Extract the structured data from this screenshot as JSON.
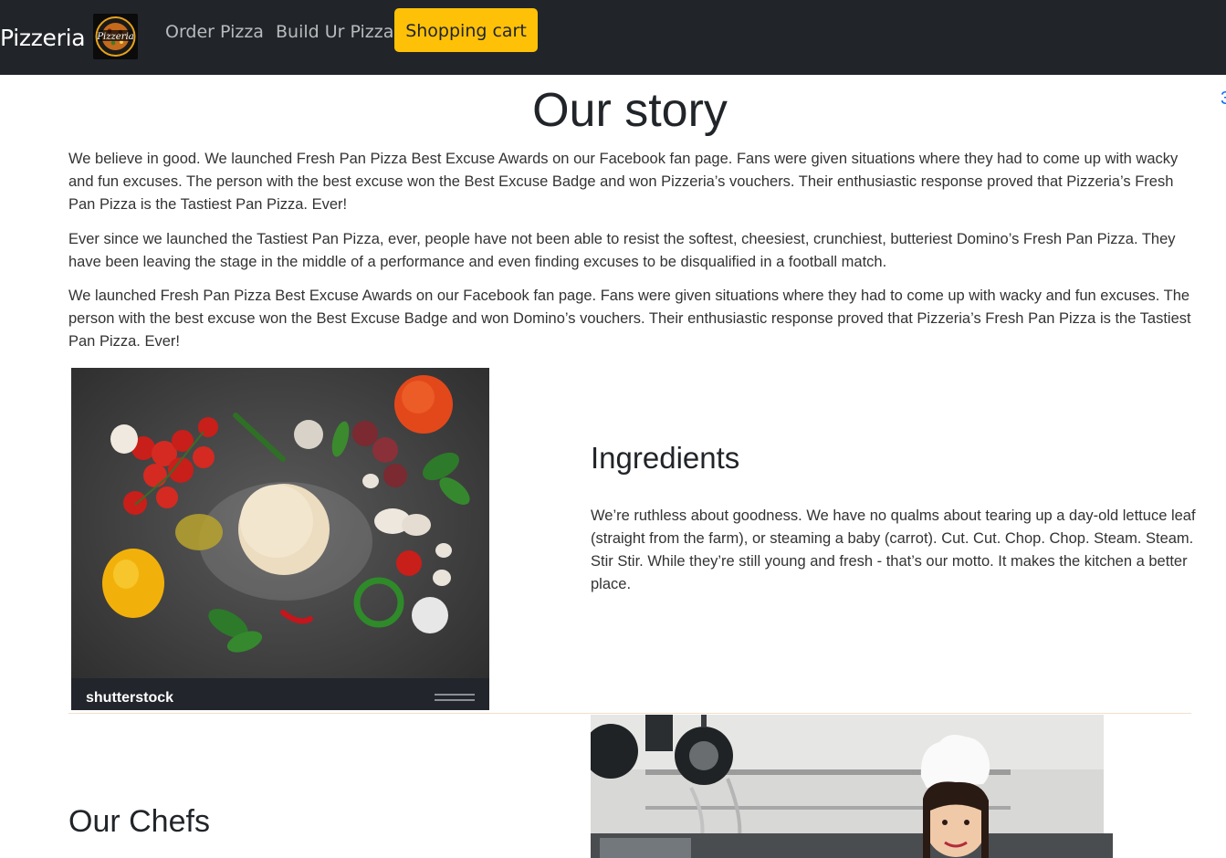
{
  "nav": {
    "brand": "Pizzeria",
    "logo_text": "Pizzeria",
    "links": [
      "Order Pizza",
      "Build Ur Pizza"
    ],
    "cart_label": "Shopping cart",
    "colors": {
      "background": "#212529",
      "cart": "#ffc107"
    }
  },
  "story": {
    "title": "Our story",
    "paragraphs": [
      "We believe in good. We launched Fresh Pan Pizza Best Excuse Awards on our Facebook fan page. Fans were given situations where they had to come up with wacky and fun excuses. The person with the best excuse won the Best Excuse Badge and won Pizzeria’s vouchers. Their enthusiastic response proved that Pizzeria’s Fresh Pan Pizza is the Tastiest Pan Pizza. Ever!",
      "Ever since we launched the Tastiest Pan Pizza, ever, people have not been able to resist the softest, cheesiest, crunchiest, butteriest Domino’s Fresh Pan Pizza. They have been leaving the stage in the middle of a performance and even finding excuses to be disqualified in a football match.",
      "We launched Fresh Pan Pizza Best Excuse Awards on our Facebook fan page. Fans were given situations where they had to come up with wacky and fun excuses. The person with the best excuse won the Best Excuse Badge and won Domino’s vouchers. Their enthusiastic response proved that Pizzeria’s Fresh Pan Pizza is the Tastiest Pan Pizza. Ever!"
    ]
  },
  "ingredients": {
    "title": "Ingredients",
    "text": "We’re ruthless about goodness. We have no qualms about tearing up a day-old lettuce leaf (straight from the farm), or steaming a baby (carrot). Cut. Cut. Chop. Chop. Steam. Steam. Stir Stir. While they’re still young and fresh - that’s our motto. It makes the kitchen a better place.",
    "image_watermark": "shutterstock"
  },
  "chefs": {
    "title": "Our Chefs"
  }
}
